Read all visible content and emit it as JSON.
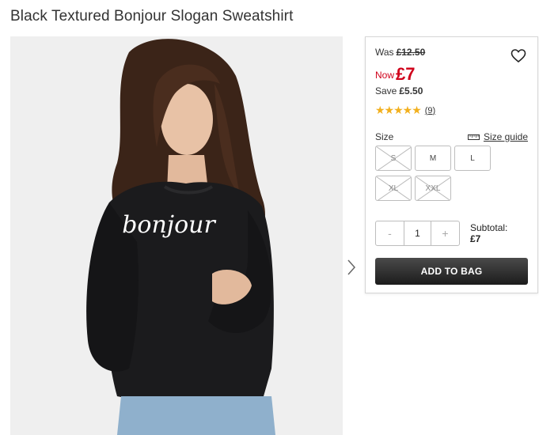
{
  "page": {
    "title": "Black Textured Bonjour Slogan Sweatshirt"
  },
  "product_image": {
    "print_text": "bonjour",
    "icon": "chevron-right-icon"
  },
  "pricing": {
    "was_label": "Was",
    "was_price": "£12.50",
    "now_label": "Now",
    "now_price": "£7",
    "save_label": "Save",
    "save_amount": "£5.50"
  },
  "rating": {
    "stars": "★★★★★",
    "value_stars": 5,
    "count": "(9)"
  },
  "size": {
    "label": "Size",
    "guide_label": "Size guide",
    "guide_icon": "ruler-icon",
    "options": [
      {
        "label": "S",
        "available": false
      },
      {
        "label": "M",
        "available": true
      },
      {
        "label": "L",
        "available": true
      },
      {
        "label": "XL",
        "available": false
      },
      {
        "label": "XXL",
        "available": false
      }
    ]
  },
  "quantity": {
    "minus": "-",
    "value": "1",
    "plus": "+"
  },
  "subtotal": {
    "label": "Subtotal:",
    "value": "£7"
  },
  "actions": {
    "add_to_bag": "ADD TO BAG",
    "wishlist_icon": "heart-icon"
  },
  "colors": {
    "sale_red": "#d0021b",
    "star_yellow": "#f2b01e",
    "button_dark": "#1c1c1c"
  }
}
